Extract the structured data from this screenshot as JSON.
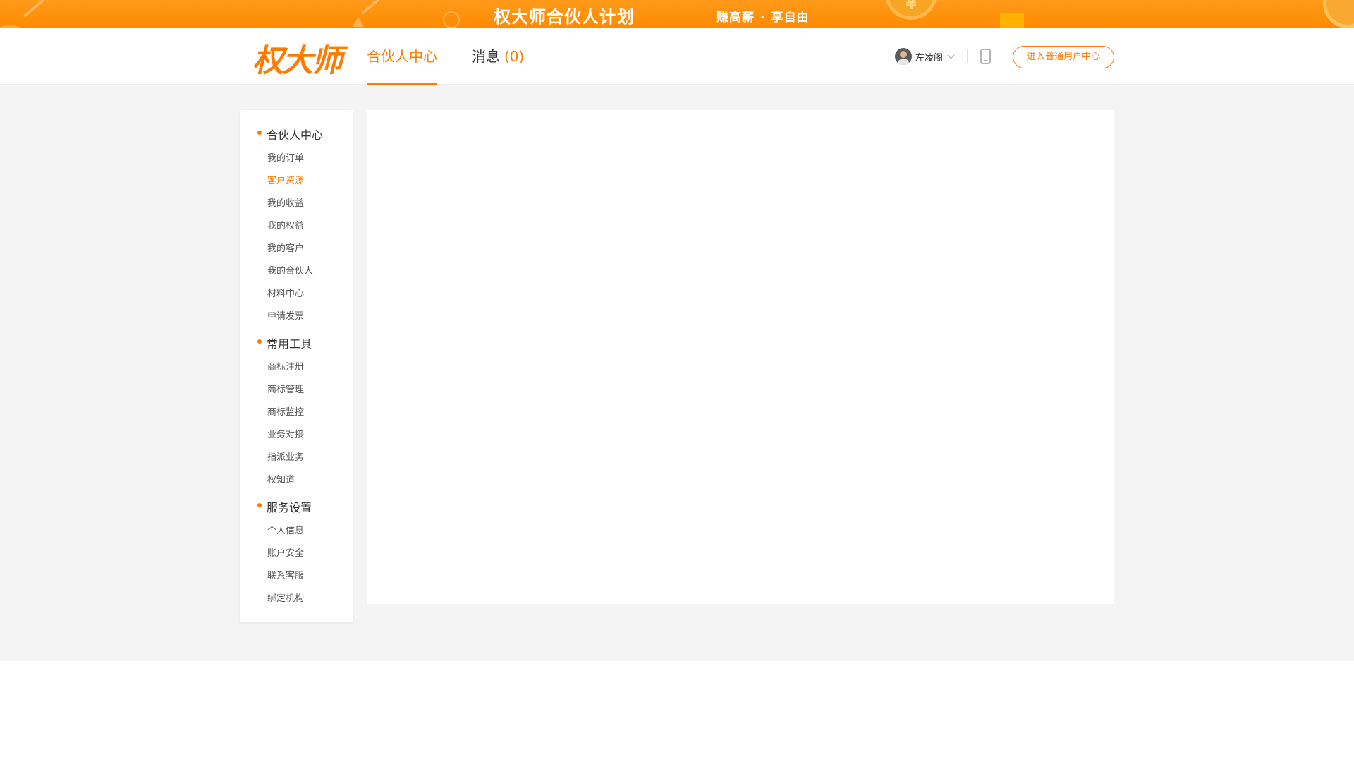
{
  "banner": {
    "headline": "权大师合伙人计划",
    "slogan_part1": "赚高薪",
    "slogan_dot": "·",
    "slogan_part2": "享自由"
  },
  "header": {
    "logo_text": "权大师",
    "tabs": [
      {
        "label": "合伙人中心",
        "active": true
      },
      {
        "label": "消息",
        "count": "(0)",
        "active": false
      }
    ],
    "user_name": "左凌阁",
    "enter_button": "进入普通用户中心"
  },
  "sidebar": {
    "groups": [
      {
        "title": "合伙人中心",
        "items": [
          "我的订单",
          "客户资源",
          "我的收益",
          "我的权益",
          "我的客户",
          "我的合伙人",
          "材料中心",
          "申请发票"
        ]
      },
      {
        "title": "常用工具",
        "items": [
          "商标注册",
          "商标管理",
          "商标监控",
          "业务对接",
          "指派业务",
          "权知道"
        ]
      },
      {
        "title": "服务设置",
        "items": [
          "个人信息",
          "账户安全",
          "联系客服",
          "绑定机构"
        ]
      }
    ],
    "active_item": "客户资源"
  },
  "colors": {
    "accent": "#ff7a00",
    "banner": "#ff8a00",
    "page_bg": "#f4f4f4"
  },
  "icons": {
    "user": "avatar",
    "dropdown": "chevron-down-icon",
    "mobile": "phone-icon",
    "bullet": "dot-icon"
  }
}
